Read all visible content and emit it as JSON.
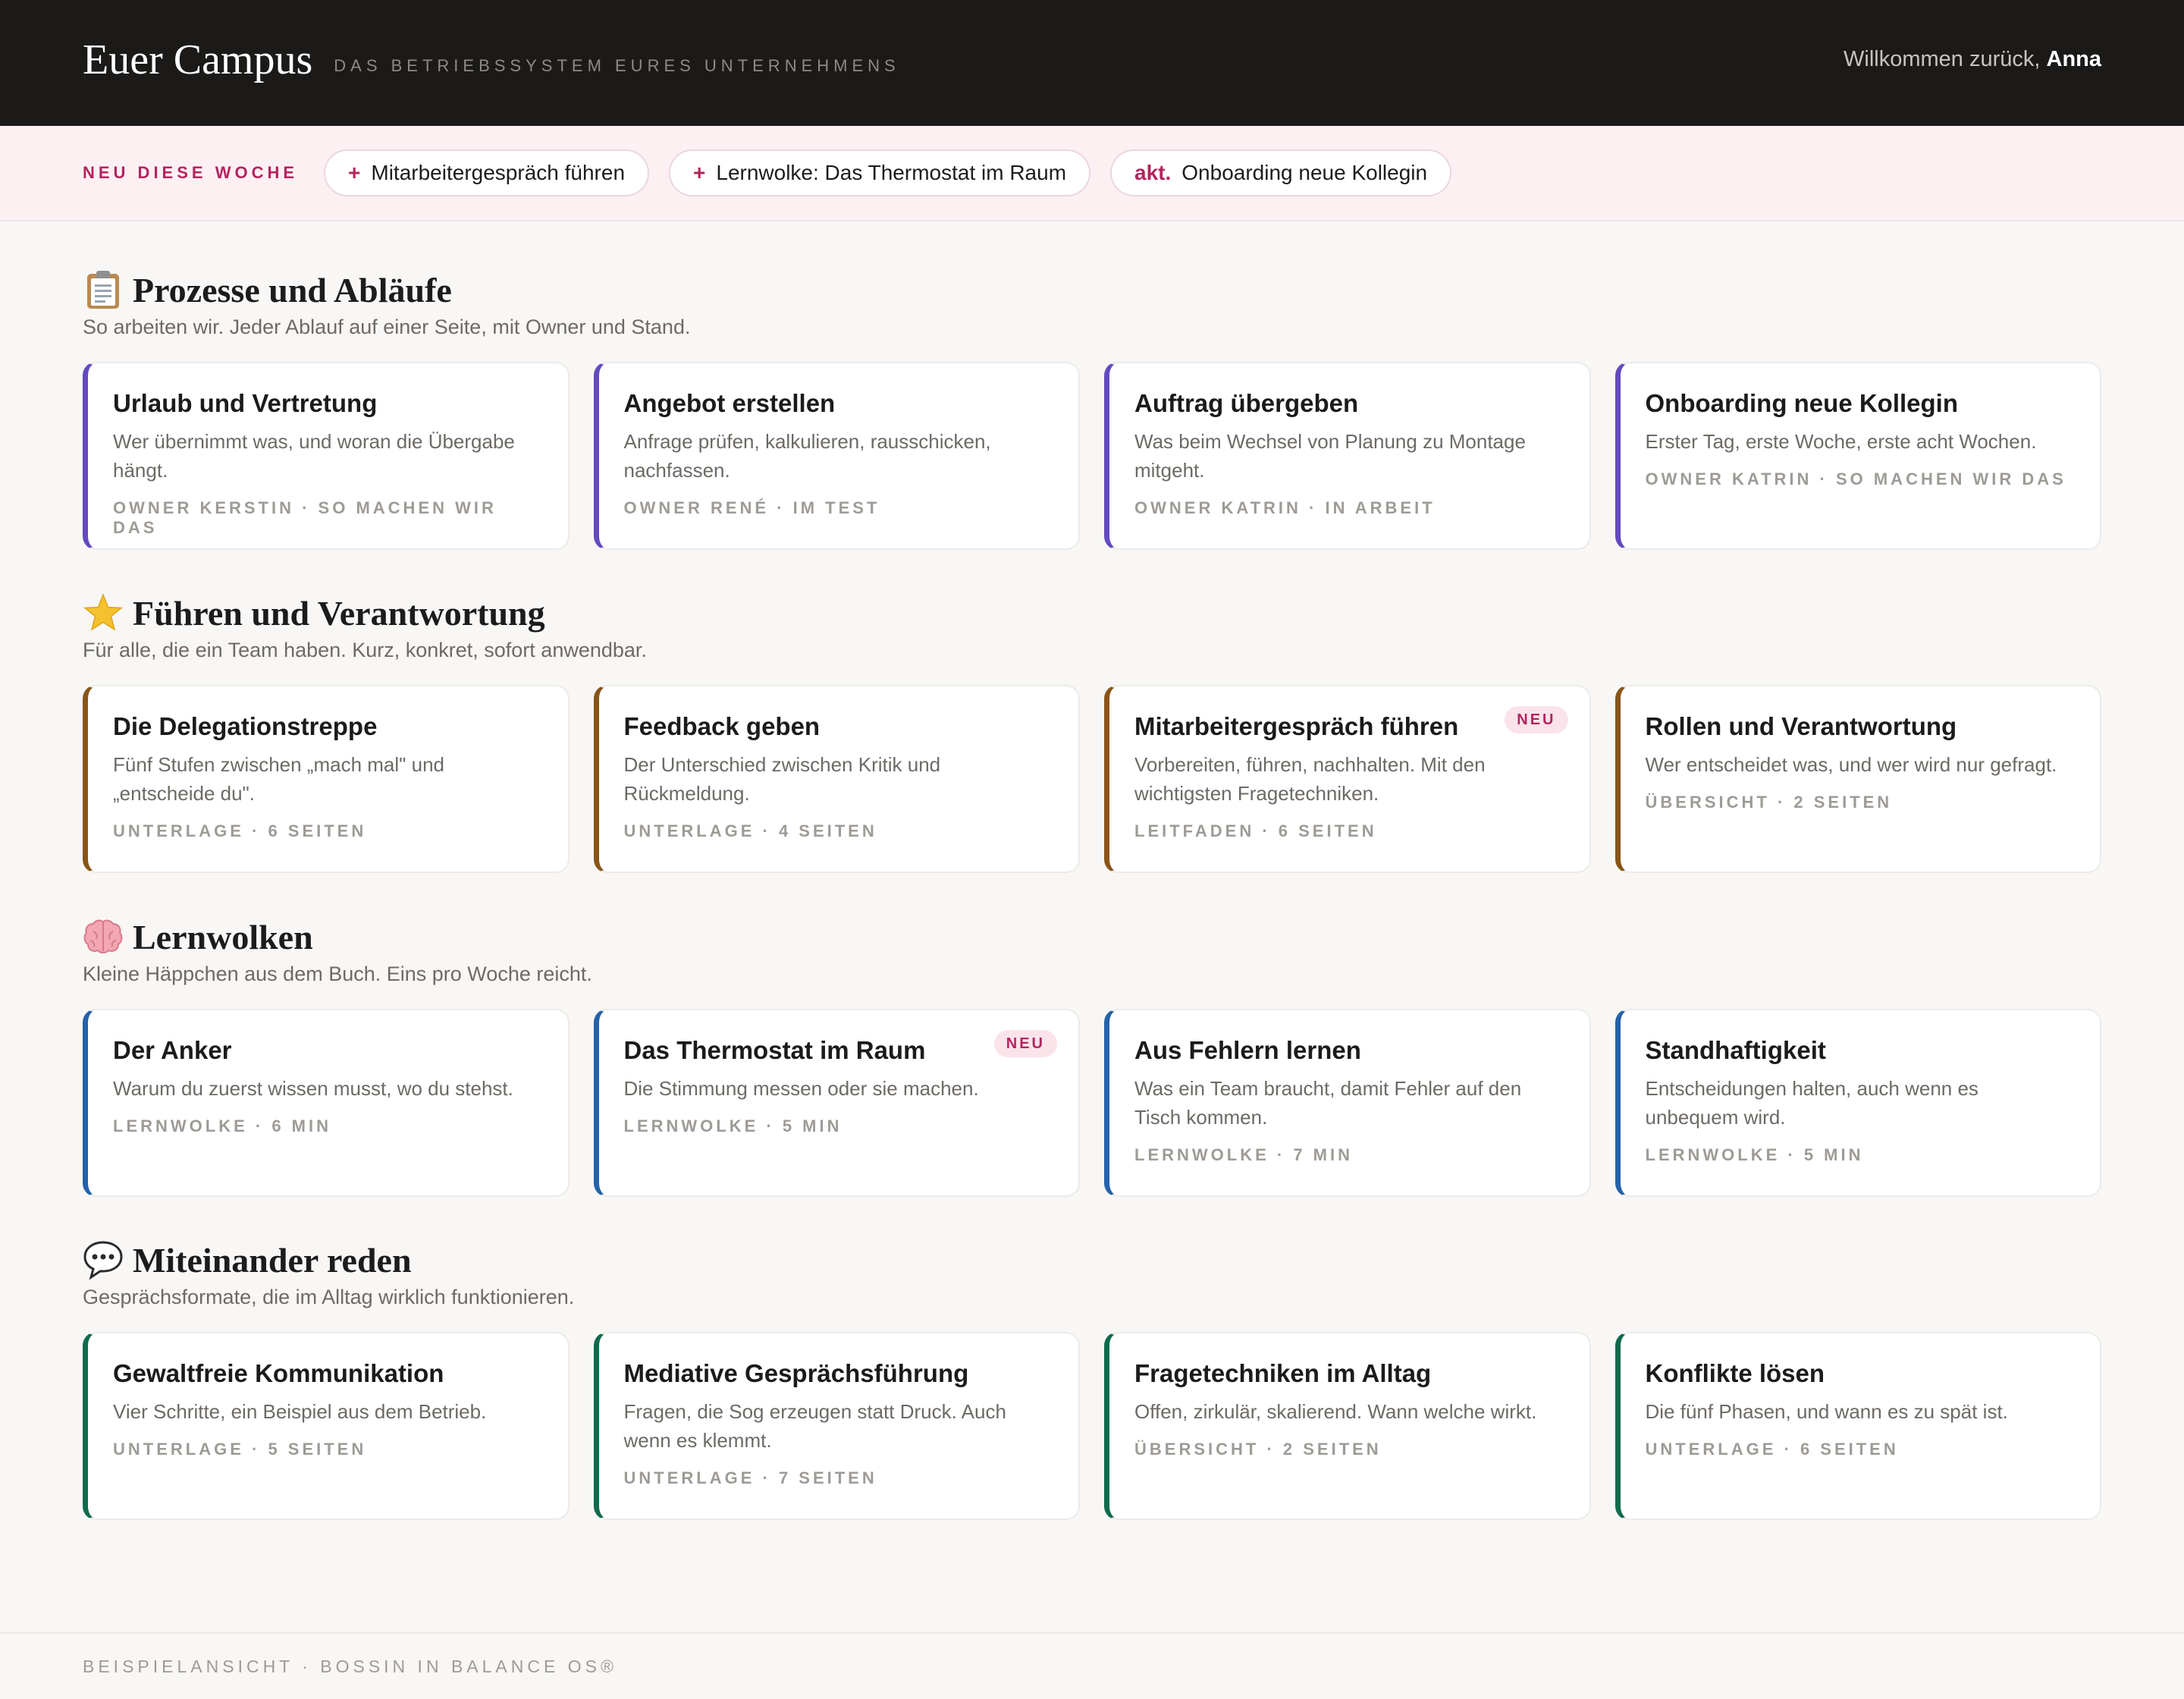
{
  "header": {
    "brand": "Euer Campus",
    "tagline": "Das Betriebssystem eures Unternehmens",
    "welcome_prefix": "Willkommen zurück,",
    "user_name": "Anna"
  },
  "news": {
    "label": "Neu diese Woche",
    "items": [
      {
        "mark": "+",
        "label": "Mitarbeitergespräch führen"
      },
      {
        "mark": "+",
        "label": "Lernwolke: Das Thermostat im Raum"
      },
      {
        "mark": "akt.",
        "label": "Onboarding neue Kollegin"
      }
    ]
  },
  "sections": [
    {
      "icon": "clipboard-icon",
      "title": "Prozesse und Abläufe",
      "subtitle": "So arbeiten wir. Jeder Ablauf auf einer Seite, mit Owner und Stand.",
      "cards": [
        {
          "title": "Urlaub und Vertretung",
          "desc": "Wer übernimmt was, und woran die Übergabe hängt.",
          "meta": "Owner Kerstin · So machen wir das"
        },
        {
          "title": "Angebot erstellen",
          "desc": "Anfrage prüfen, kalkulieren, rausschicken, nachfassen.",
          "meta": "Owner René · Im Test"
        },
        {
          "title": "Auftrag übergeben",
          "desc": "Was beim Wechsel von Planung zu Montage mitgeht.",
          "meta": "Owner Katrin · In Arbeit"
        },
        {
          "title": "Onboarding neue Kollegin",
          "desc": "Erster Tag, erste Woche, erste acht Wochen.",
          "meta": "Owner Katrin · So machen wir das"
        }
      ]
    },
    {
      "icon": "star-icon",
      "title": "Führen und Verantwortung",
      "subtitle": "Für alle, die ein Team haben. Kurz, konkret, sofort anwendbar.",
      "cards": [
        {
          "title": "Die Delegationstreppe",
          "desc": "Fünf Stufen zwischen „mach mal\" und „entscheide du\".",
          "meta": "Unterlage · 6 Seiten"
        },
        {
          "title": "Feedback geben",
          "desc": "Der Unterschied zwischen Kritik und Rückmeldung.",
          "meta": "Unterlage · 4 Seiten"
        },
        {
          "title": "Mitarbeitergespräch führen",
          "desc": "Vorbereiten, führen, nachhalten. Mit den wichtigsten Fragetechniken.",
          "meta": "Leitfaden · 6 Seiten",
          "badge": "NEU"
        },
        {
          "title": "Rollen und Verantwortung",
          "desc": "Wer entscheidet was, und wer wird nur gefragt.",
          "meta": "Übersicht · 2 Seiten"
        }
      ]
    },
    {
      "icon": "brain-icon",
      "title": "Lernwolken",
      "subtitle": "Kleine Häppchen aus dem Buch. Eins pro Woche reicht.",
      "cards": [
        {
          "title": "Der Anker",
          "desc": "Warum du zuerst wissen musst, wo du stehst.",
          "meta": "Lernwolke · 6 Min"
        },
        {
          "title": "Das Thermostat im Raum",
          "desc": "Die Stimmung messen oder sie machen.",
          "meta": "Lernwolke · 5 Min",
          "badge": "NEU"
        },
        {
          "title": "Aus Fehlern lernen",
          "desc": "Was ein Team braucht, damit Fehler auf den Tisch kommen.",
          "meta": "Lernwolke · 7 Min"
        },
        {
          "title": "Standhaftigkeit",
          "desc": "Entscheidungen halten, auch wenn es unbequem wird.",
          "meta": "Lernwolke · 5 Min"
        }
      ]
    },
    {
      "icon": "speech-bubble-icon",
      "title": "Miteinander reden",
      "subtitle": "Gesprächsformate, die im Alltag wirklich funktionieren.",
      "cards": [
        {
          "title": "Gewaltfreie Kommunikation",
          "desc": "Vier Schritte, ein Beispiel aus dem Betrieb.",
          "meta": "Unterlage · 5 Seiten"
        },
        {
          "title": "Mediative Gesprächsführung",
          "desc": "Fragen, die Sog erzeugen statt Druck. Auch wenn es klemmt.",
          "meta": "Unterlage · 7 Seiten"
        },
        {
          "title": "Fragetechniken im Alltag",
          "desc": "Offen, zirkulär, skalierend. Wann welche wirkt.",
          "meta": "Übersicht · 2 Seiten"
        },
        {
          "title": "Konflikte lösen",
          "desc": "Die fünf Phasen, und wann es zu spät ist.",
          "meta": "Unterlage · 6 Seiten"
        }
      ]
    }
  ],
  "colors": {
    "accent_pink": "#b3245f",
    "processes": "#6449c0",
    "leadership": "#8a5417",
    "learning": "#2462aa",
    "communication": "#0e6b4c"
  },
  "footer": {
    "text": "Beispielansicht · Bossin in Balance OS®"
  }
}
